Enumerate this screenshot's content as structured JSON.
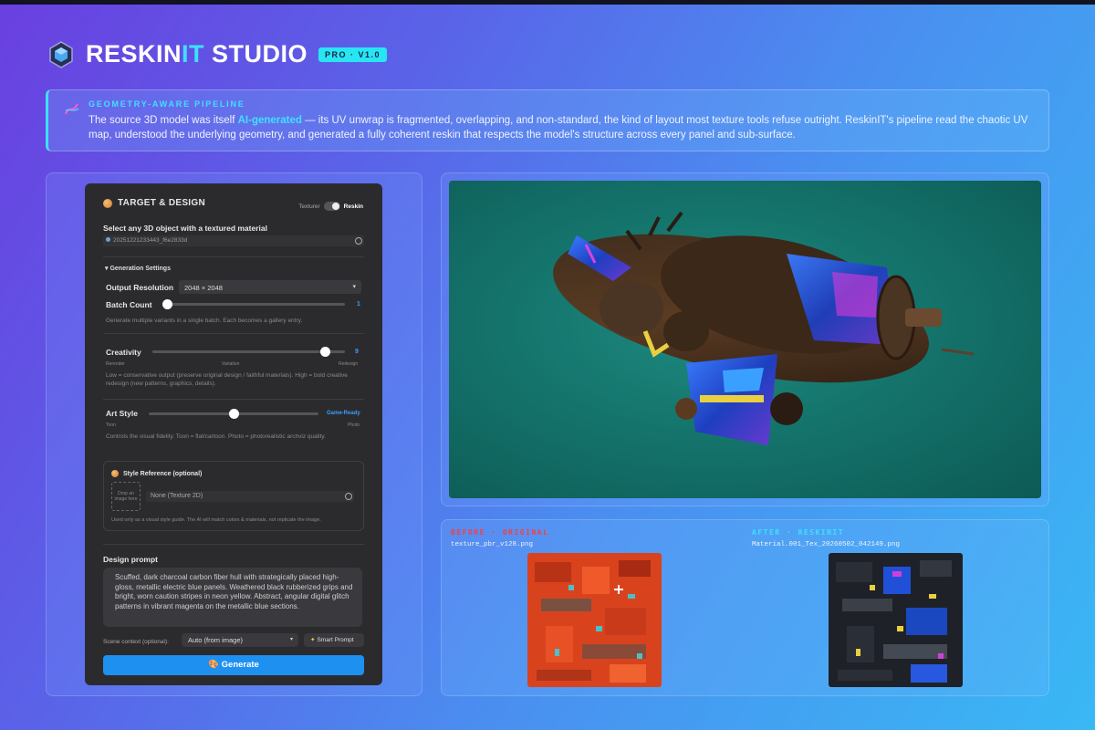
{
  "brand": {
    "title_part1": "RESKIN",
    "title_part2": "IT",
    "title_part3": " STUDIO",
    "badge": "PRO · V1.0"
  },
  "pipeline": {
    "title": "GEOMETRY-AWARE PIPELINE",
    "text_before": "The source 3D model was itself ",
    "text_highlight": "AI-generated",
    "text_after": " — its UV unwrap is fragmented, overlapping, and non-standard, the kind of layout most texture tools refuse outright. ReskinIT's pipeline read the chaotic UV map, understood the underlying geometry, and generated a fully coherent reskin that respects the model's structure across every panel and sub-surface."
  },
  "form": {
    "section_title": "TARGET & DESIGN",
    "mode_left": "Texturer",
    "mode_right": "Reskin",
    "object_label": "Select any 3D object with a textured material",
    "object_value": "20251221233443_f6e2833d",
    "gen_settings": "▾  Generation Settings",
    "output_resolution_label": "Output Resolution",
    "output_resolution_value": "2048 × 2048",
    "batch_label": "Batch Count",
    "batch_value": "1",
    "batch_help": "Generate multiple variants in a single batch. Each becomes a gallery entry.",
    "creativity_label": "Creativity",
    "creativity_value": "9",
    "creativity_min": "Rerender",
    "creativity_mid": "Variation",
    "creativity_max": "Redesign",
    "creativity_help": "Low = conservative output (preserve original design / faithful materials). High = bold creative redesign (new patterns, graphics, details).",
    "art_style_label": "Art Style",
    "art_style_value": "Game-Ready",
    "art_style_min": "Toon",
    "art_style_max": "Photo",
    "art_style_help": "Controls the visual fidelity. Toon = flat/cartoon. Photo = photorealistic archviz quality.",
    "style_ref_label": "Style Reference (optional)",
    "drop_zone": "Drop an image here",
    "style_ref_value": "None (Texture 2D)",
    "style_ref_help": "Used only as a visual style guide. The AI will match colors & materials, not replicate the image.",
    "prompt_label": "Design prompt",
    "prompt_text": "Scuffed, dark charcoal carbon fiber hull with strategically placed high-gloss, metallic electric blue panels. Weathered black rubberized grips and bright, worn caution stripes in neon yellow. Abstract, angular digital glitch patterns in vibrant magenta on the metallic blue sections.",
    "scene_label": "Scene context (optional):",
    "scene_value": "Auto (from image)",
    "smart_prompt": "Smart Prompt",
    "generate": "Generate"
  },
  "sliders": {
    "batch_fraction": 0.0,
    "creativity_fraction": 0.9,
    "art_style_fraction": 0.5
  },
  "textures": {
    "before_title": "BEFORE · ORIGINAL",
    "before_file": "texture_pbr_v128.png",
    "after_title": "AFTER · RESKINIT",
    "after_file": "Material.001_Tex_20260502_042149.png"
  },
  "colors": {
    "accent": "#3fe0ff",
    "before": "#ff3b3b",
    "after": "#3fe0ff",
    "primary_button": "#1e90f0"
  }
}
